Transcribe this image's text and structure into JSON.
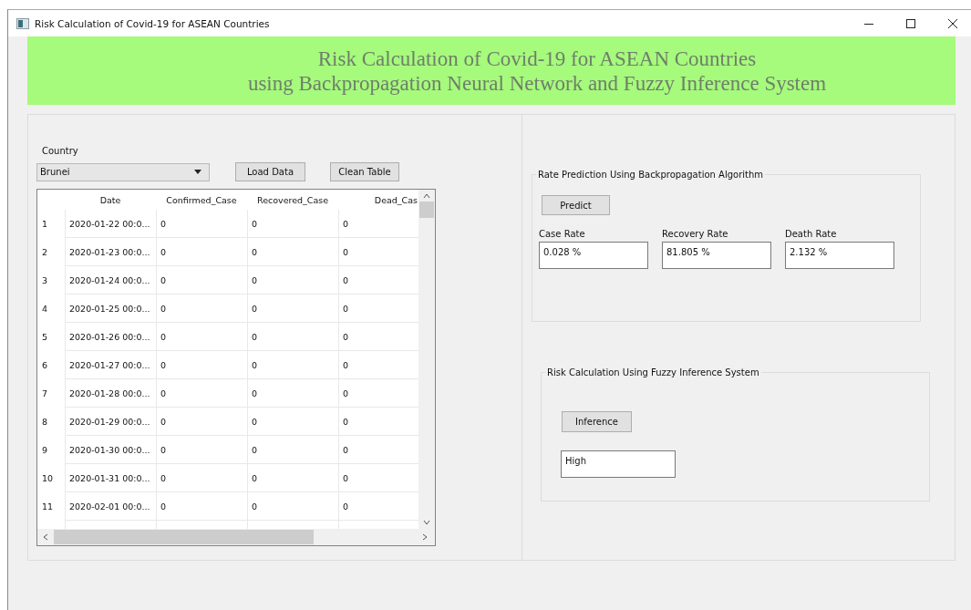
{
  "window": {
    "title": "Risk Calculation of Covid-19 for ASEAN Countries"
  },
  "banner": {
    "lines": [
      "Risk Calculation of Covid-19 for ASEAN Countries",
      "using Backpropagation Neural Network and Fuzzy Inference System"
    ]
  },
  "data_panel": {
    "country_label": "Country",
    "country_value": "Brunei",
    "buttons": [
      "Load Data",
      "Clean Table"
    ],
    "table": {
      "columns": [
        "Date",
        "Confirmed_Case",
        "Recovered_Case",
        "Dead_Cas"
      ],
      "rows": [
        {
          "index": "1",
          "cells": [
            "2020-01-22 00:0...",
            "0",
            "0",
            "0"
          ]
        },
        {
          "index": "2",
          "cells": [
            "2020-01-23 00:0...",
            "0",
            "0",
            "0"
          ]
        },
        {
          "index": "3",
          "cells": [
            "2020-01-24 00:0...",
            "0",
            "0",
            "0"
          ]
        },
        {
          "index": "4",
          "cells": [
            "2020-01-25 00:0...",
            "0",
            "0",
            "0"
          ]
        },
        {
          "index": "5",
          "cells": [
            "2020-01-26 00:0...",
            "0",
            "0",
            "0"
          ]
        },
        {
          "index": "6",
          "cells": [
            "2020-01-27 00:0...",
            "0",
            "0",
            "0"
          ]
        },
        {
          "index": "7",
          "cells": [
            "2020-01-28 00:0...",
            "0",
            "0",
            "0"
          ]
        },
        {
          "index": "8",
          "cells": [
            "2020-01-29 00:0...",
            "0",
            "0",
            "0"
          ]
        },
        {
          "index": "9",
          "cells": [
            "2020-01-30 00:0...",
            "0",
            "0",
            "0"
          ]
        },
        {
          "index": "10",
          "cells": [
            "2020-01-31 00:0...",
            "0",
            "0",
            "0"
          ]
        },
        {
          "index": "11",
          "cells": [
            "2020-02-01 00:0...",
            "0",
            "0",
            "0"
          ]
        }
      ]
    }
  },
  "prediction": {
    "title": "Rate Prediction Using Backpropagation Algorithm",
    "button": "Predict",
    "fields": [
      {
        "label": "Case Rate",
        "value": "0.028 %"
      },
      {
        "label": "Recovery Rate",
        "value": "81.805 %"
      },
      {
        "label": "Death Rate",
        "value": "2.132 %"
      }
    ]
  },
  "fuzzy": {
    "title": "Risk Calculation Using Fuzzy Inference System",
    "button": "Inference",
    "value": "High"
  }
}
